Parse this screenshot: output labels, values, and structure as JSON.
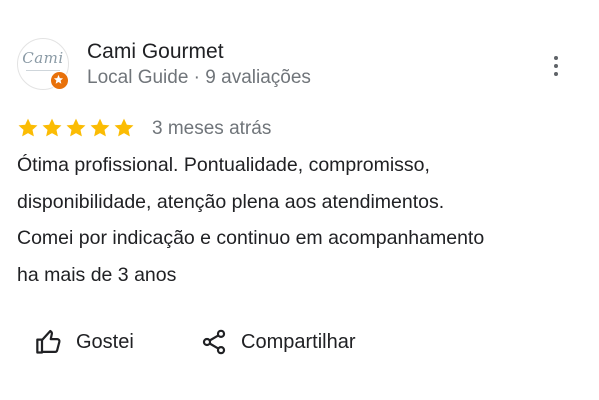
{
  "review": {
    "author": {
      "name": "Cami Gourmet",
      "meta": "Local Guide · 9 avaliações",
      "avatar_text": "Cami",
      "avatar_icon": "cami-gourmet-logo",
      "badge_icon": "local-guide-star-icon",
      "badge_color": "#e8710a"
    },
    "rating": {
      "stars": 5,
      "max_stars": 5,
      "star_color": "#fbbc04",
      "date": "3 meses atrás"
    },
    "text_lines": [
      "Ótima profissional. Pontualidade, compromisso,",
      "disponibilidade, atenção plena aos atendimentos.",
      "Comei por indicação e continuo em acompanhamento",
      "ha mais de 3 anos"
    ],
    "actions": {
      "like": {
        "label": "Gostei",
        "icon": "thumbs-up-icon"
      },
      "share": {
        "label": "Compartilhar",
        "icon": "share-icon"
      }
    },
    "menu_icon": "more-vert-icon"
  }
}
